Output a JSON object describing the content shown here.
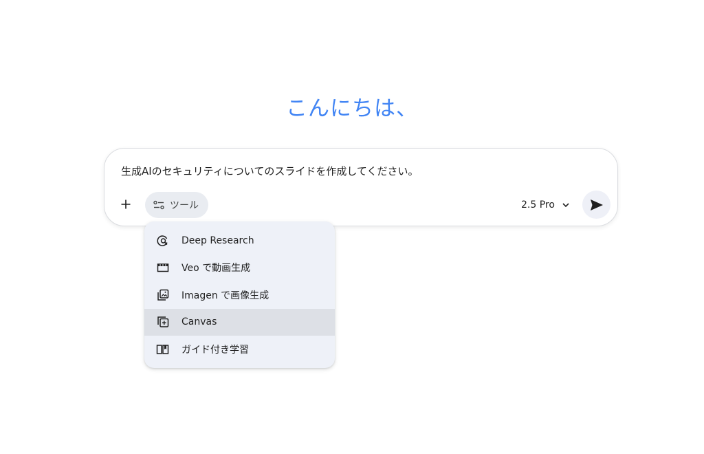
{
  "greeting": "こんにちは、",
  "composer": {
    "prompt_text": "生成AIのセキュリティについてのスライドを作成してください。",
    "add_label": "+",
    "tools_label": "ツール",
    "model_label": "2.5 Pro"
  },
  "tools_menu": {
    "items": [
      {
        "label": "Deep Research",
        "icon": "deep-research-icon"
      },
      {
        "label": "Veo で動画生成",
        "icon": "video-icon"
      },
      {
        "label": "Imagen で画像生成",
        "icon": "image-icon"
      },
      {
        "label": "Canvas",
        "icon": "canvas-icon"
      },
      {
        "label": "ガイド付き学習",
        "icon": "book-icon"
      }
    ],
    "highlighted_item": "Canvas"
  },
  "colors": {
    "greeting": "#4285f4",
    "menu_background": "#eef1f8",
    "menu_highlight": "#dde0e6",
    "tools_chip": "#e9ecf1",
    "send_button": "#eef0f7"
  }
}
